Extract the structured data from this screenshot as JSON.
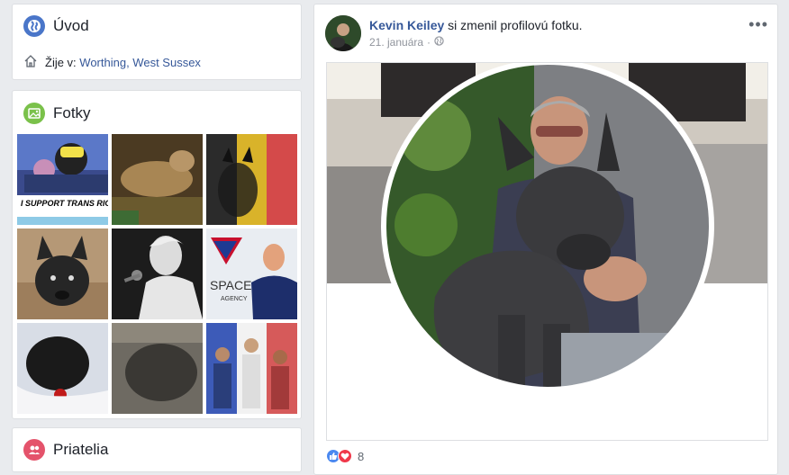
{
  "intro": {
    "title": "Úvod",
    "lives_label": "Žije v:",
    "city": "Worthing, West Sussex"
  },
  "photos": {
    "title": "Fotky",
    "tiles": [
      {
        "caption": "I SUPPORT TRANS RIGHTS"
      },
      {
        "caption": ""
      },
      {
        "caption": ""
      },
      {
        "caption": ""
      },
      {
        "caption": ""
      },
      {
        "caption": "SPACE AGENCY"
      },
      {
        "caption": ""
      },
      {
        "caption": ""
      },
      {
        "caption": ""
      }
    ]
  },
  "friends": {
    "title": "Priatelia"
  },
  "post": {
    "author": "Kevin Keiley",
    "action": " si zmenil profilovú fotku.",
    "date": "21. januára",
    "reaction_count": "8"
  },
  "icons": {
    "intro": "globe-icon",
    "photos": "image-icon",
    "friends": "friends-icon",
    "home": "home-icon",
    "privacy": "globe-privacy-icon",
    "more": "more-options-icon",
    "like": "like-icon",
    "love": "love-icon"
  }
}
